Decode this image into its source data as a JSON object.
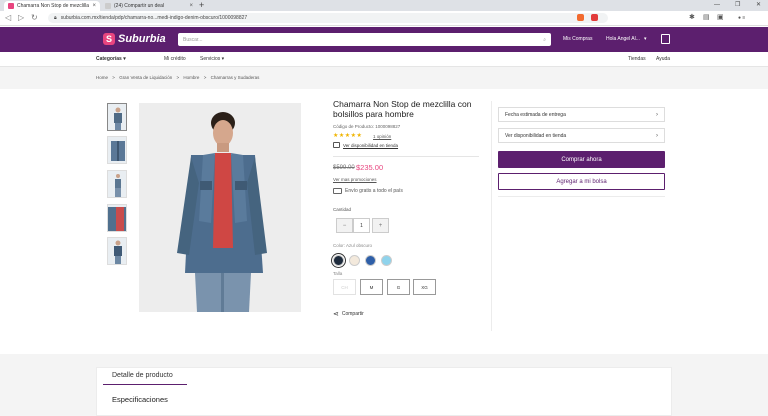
{
  "browser": {
    "tabs": [
      {
        "title": "Chamarra Non Stop de mezclilla"
      },
      {
        "title": "(24) Compartir un deal"
      }
    ],
    "url": "suburbia.com.mx/tienda/pdp/chamarra-no...medi-indigo-denim-obscuro/1000098827"
  },
  "header": {
    "logo_text": "Suburbia",
    "search_placeholder": "Buscar...",
    "my_orders": "Mis Compras",
    "greeting": "Hola Angel Al..."
  },
  "subnav": {
    "categories": "Categorías",
    "credit": "Mi crédito",
    "services": "Servicios",
    "stores": "Tiendas",
    "help": "Ayuda"
  },
  "breadcrumb": [
    "Home",
    ">",
    "Gran Venta de Liquidación",
    ">",
    "Hombre",
    ">",
    "Chamarras y Sudaderas"
  ],
  "product": {
    "title": "Chamarra Non Stop de mezclilla con bolsillos para hombre",
    "code": "Código de Producto: 1000098827",
    "stars": "★★★★★",
    "reviews": "1 opinión",
    "stock_link": "Ver disponibilidad en tienda",
    "price_old": "$599.00",
    "price_new": "$235.00",
    "promos_link": "Ver mas promociones",
    "shipping": "Envío gratis a todo el país",
    "quantity_label": "Cantidad",
    "quantity": "1",
    "qty_minus": "−",
    "qty_plus": "+",
    "color_label": "Color: Azul obscuro",
    "colors": [
      "#1e2b3c",
      "#f3e9dc",
      "#2e5fa8",
      "#8fd3ec"
    ],
    "size_label": "Talla",
    "sizes": [
      "CH",
      "M",
      "G",
      "XG"
    ],
    "share": "Compartir"
  },
  "panel": {
    "delivery": "Fecha estimada de entrega",
    "availability": "Ver disponibilidad en tienda",
    "buy_now": "Comprar ahora",
    "add_to_bag": "Agregar a mi bolsa"
  },
  "details": {
    "tab": "Detalle de producto",
    "specs": "Especificaciones"
  }
}
